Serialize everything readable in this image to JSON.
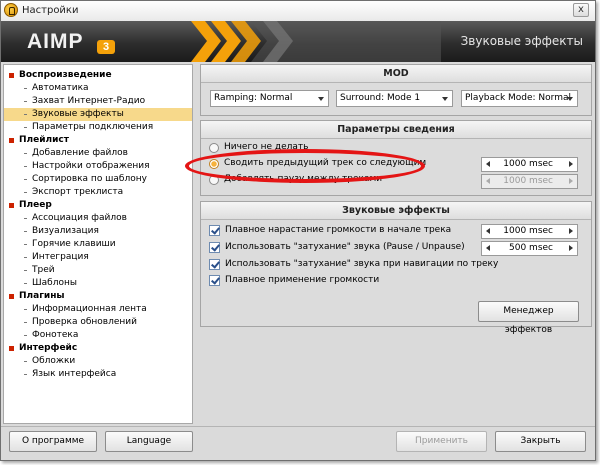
{
  "window": {
    "title": "Настройки",
    "close_glyph": "x"
  },
  "header": {
    "logo": "AIMP",
    "logo_version": "3",
    "section_title": "Звуковые эффекты"
  },
  "sidebar": {
    "groups": [
      {
        "label": "Воспроизведение",
        "items": [
          "Автоматика",
          "Захват Интернет-Радио",
          "Звуковые эффекты",
          "Параметры подключения"
        ]
      },
      {
        "label": "Плейлист",
        "items": [
          "Добавление файлов",
          "Настройки отображения",
          "Сортировка по шаблону",
          "Экспорт треклиста"
        ]
      },
      {
        "label": "Плеер",
        "items": [
          "Ассоциация файлов",
          "Визуализация",
          "Горячие клавиши",
          "Интеграция",
          "Трей",
          "Шаблоны"
        ]
      },
      {
        "label": "Плагины",
        "items": [
          "Информационная лента",
          "Проверка обновлений",
          "Фонотека"
        ]
      },
      {
        "label": "Интерфейс",
        "items": [
          "Обложки",
          "Язык интерфейса"
        ]
      }
    ],
    "selected": "Звуковые эффекты"
  },
  "mod": {
    "title": "MOD",
    "ramping": "Ramping: Normal",
    "surround": "Surround: Mode 1",
    "playback": "Playback Mode: Normal"
  },
  "mixing": {
    "title": "Параметры сведения",
    "option_none": "Ничего не делать",
    "option_crossfade": "Сводить предыдущий трек со следующим",
    "option_pause": "Добавлять паузу между треками",
    "crossfade_value": "1000 msec",
    "pause_value": "1000 msec"
  },
  "effects": {
    "title": "Звуковые эффекты",
    "fade_in_label": "Плавное нарастание громкости в начале трека",
    "fade_in_value": "1000 msec",
    "fade_pause_label": "Использовать \"затухание\" звука (Pause / Unpause)",
    "fade_pause_value": "500 msec",
    "fade_nav_label": "Использовать \"затухание\" звука при навигации по треку",
    "smooth_volume_label": "Плавное применение громкости",
    "manager_button": "Менеджер эффектов"
  },
  "footer": {
    "about": "О программе",
    "language": "Language",
    "apply": "Применить",
    "close": "Закрыть"
  },
  "colors": {
    "accent": "#f4a10a",
    "selection": "#f7d98b",
    "highlight_ring": "#e41515"
  }
}
